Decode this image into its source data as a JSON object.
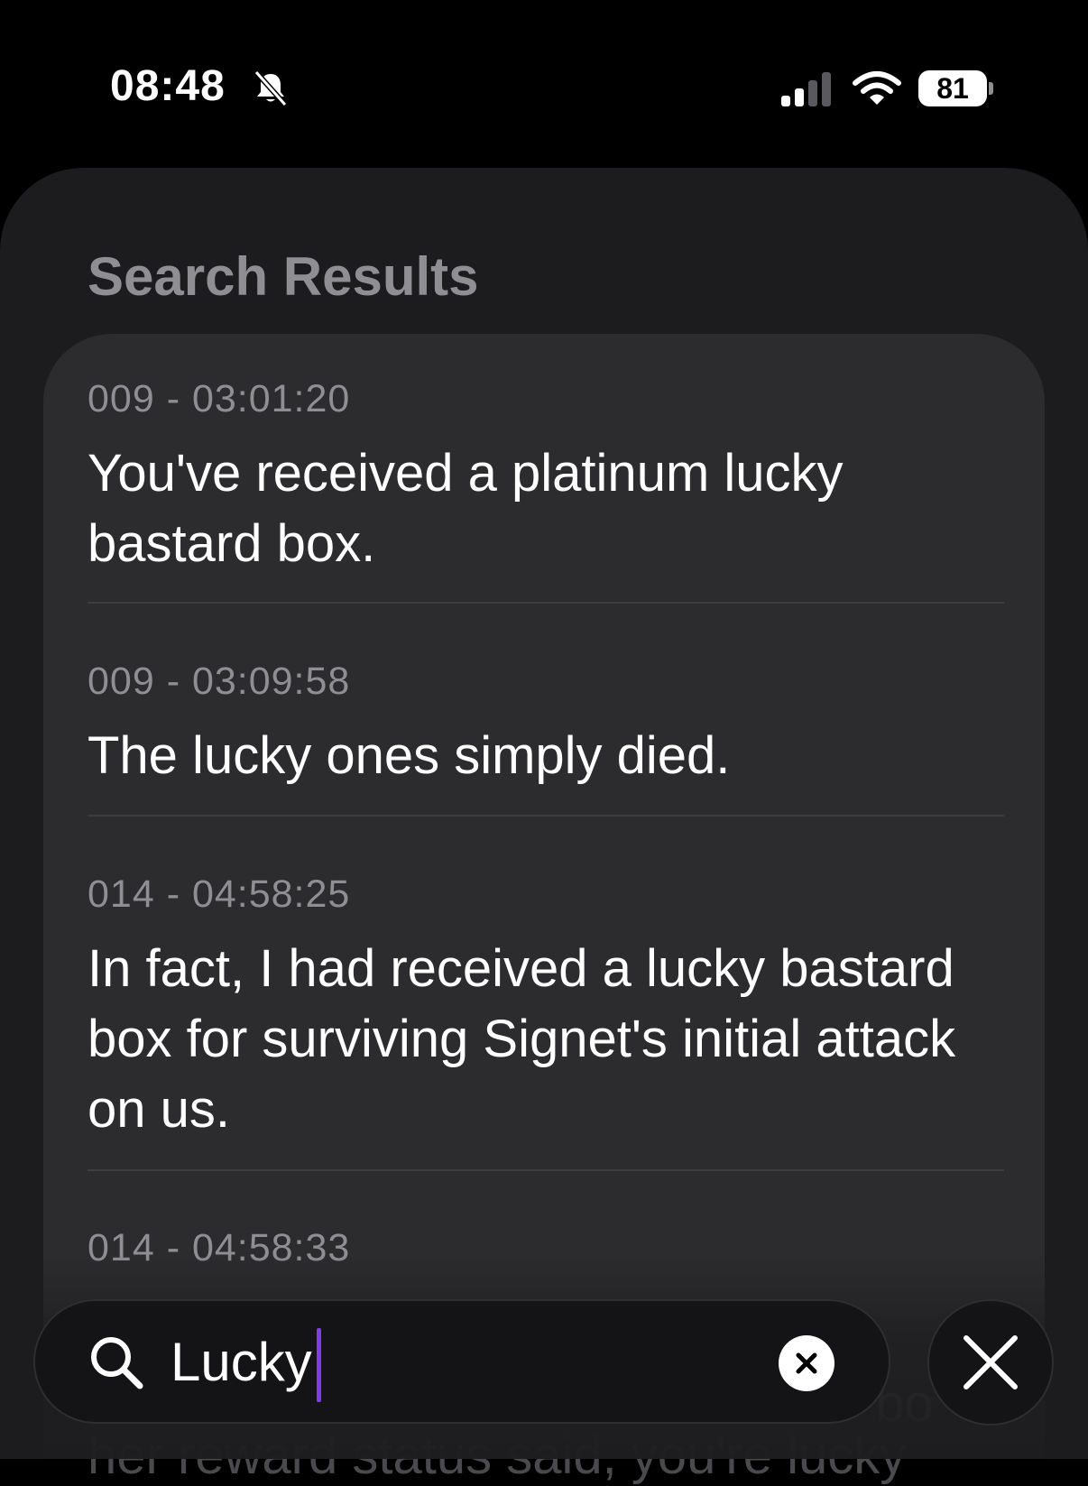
{
  "status_bar": {
    "time": "08:48",
    "battery_level": "81",
    "icons": [
      "bell-slash-icon",
      "cellular-signal-icon",
      "wifi-icon",
      "battery-icon"
    ]
  },
  "sheet": {
    "title": "Search Results",
    "results": [
      {
        "timestamp": "009 - 03:01:20",
        "text": "You've received a platinum lucky bastard box."
      },
      {
        "timestamp": "009 - 03:09:58",
        "text": "The lucky ones simply died."
      },
      {
        "timestamp": "014 - 04:58:25",
        "text": "In fact, I had received a lucky bastard box for surviving Signet's initial attack on us."
      },
      {
        "timestamp": "014 - 04:58:33",
        "text": "",
        "partial_lines": [
          "bo",
          "her reward status said, you're lucky"
        ]
      }
    ]
  },
  "search": {
    "value": "Lucky",
    "icon": "search-icon",
    "clear_icon": "clear-circle-icon",
    "close_icon": "close-icon"
  },
  "colors": {
    "background": "#000000",
    "sheet": "#1c1c1e",
    "card": "#2c2c2e",
    "secondary_text": "#8e8e93",
    "caret": "#7b3fe4"
  }
}
